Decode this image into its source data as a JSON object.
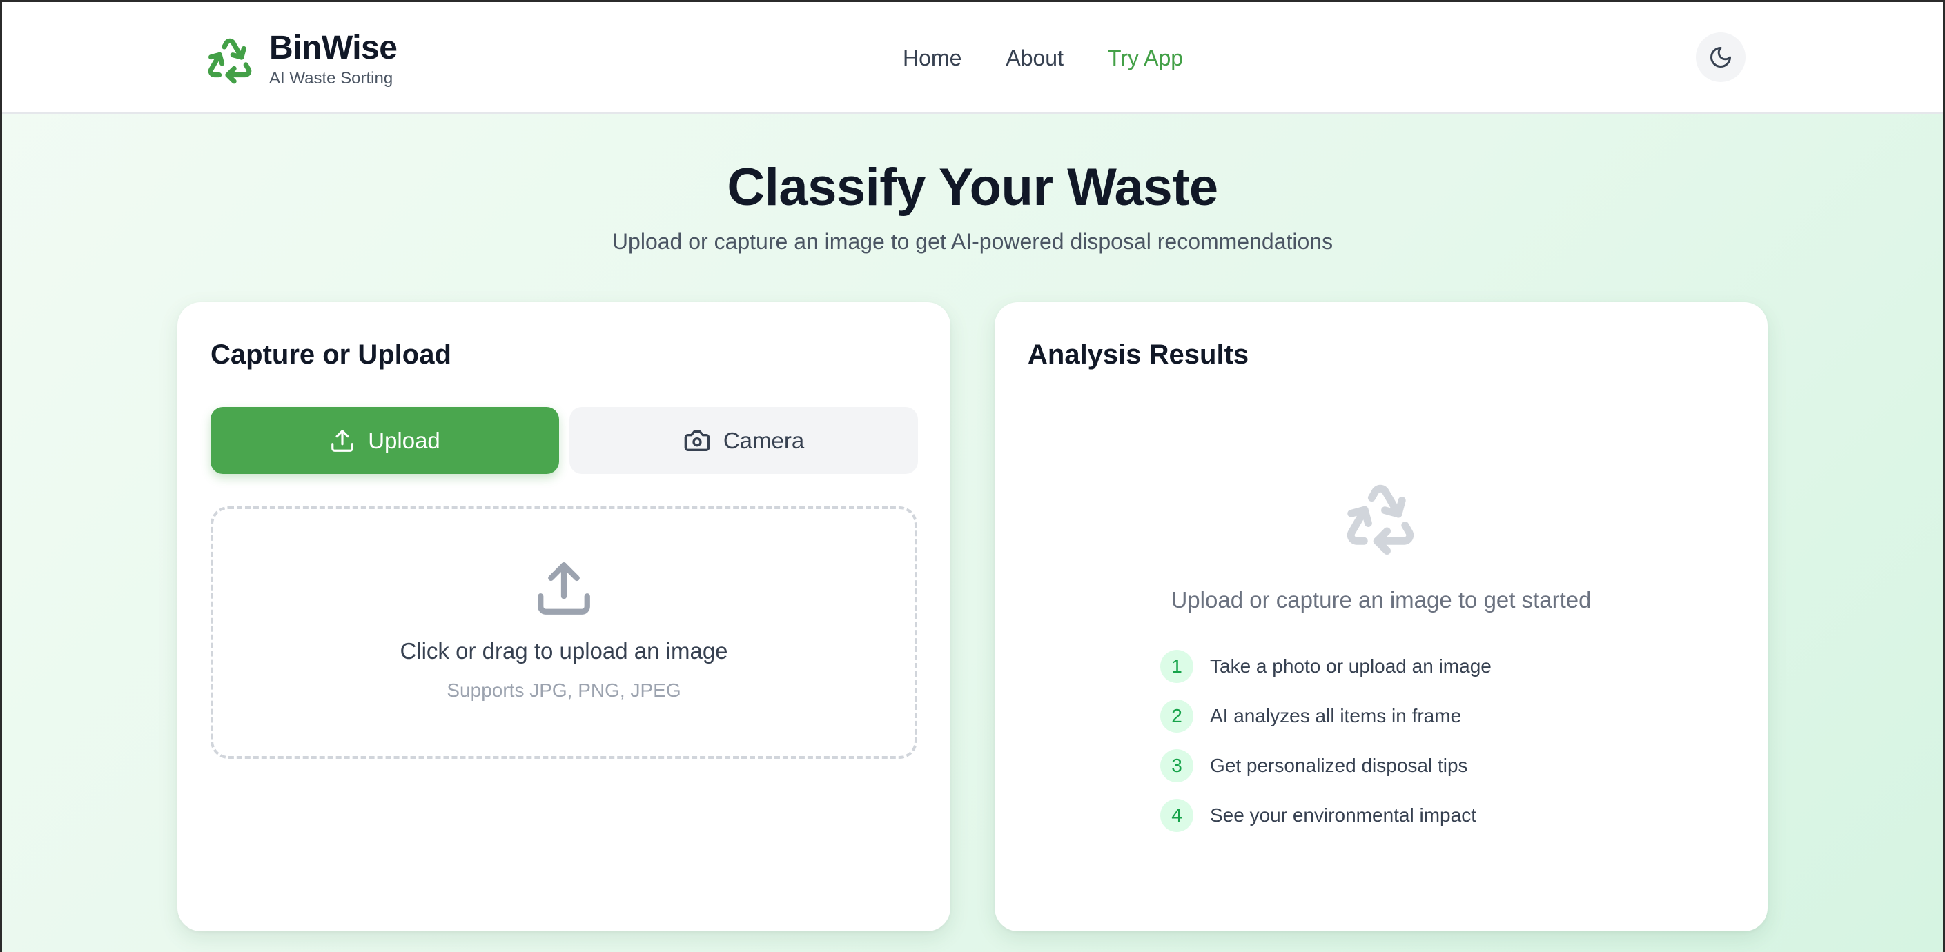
{
  "brand": {
    "name": "BinWise",
    "tagline": "AI Waste Sorting",
    "logo_icon": "recycle-icon",
    "accent_color": "#43a047"
  },
  "nav": {
    "links": [
      {
        "label": "Home",
        "active": false
      },
      {
        "label": "About",
        "active": false
      },
      {
        "label": "Try App",
        "active": true
      }
    ],
    "theme_toggle_icon": "moon-icon"
  },
  "hero": {
    "title": "Classify Your Waste",
    "subtitle": "Upload or capture an image to get AI-powered disposal recommendations"
  },
  "capture_card": {
    "title": "Capture or Upload",
    "tabs": [
      {
        "label": "Upload",
        "icon": "upload-icon",
        "selected": true
      },
      {
        "label": "Camera",
        "icon": "camera-icon",
        "selected": false
      }
    ],
    "dropzone": {
      "icon": "upload-icon",
      "title": "Click or drag to upload an image",
      "hint": "Supports JPG, PNG, JPEG"
    }
  },
  "results_card": {
    "title": "Analysis Results",
    "empty_icon": "recycle-icon",
    "empty_message": "Upload or capture an image to get started",
    "steps": [
      {
        "number": "1",
        "text": "Take a photo or upload an image"
      },
      {
        "number": "2",
        "text": "AI analyzes all items in frame"
      },
      {
        "number": "3",
        "text": "Get personalized disposal tips"
      },
      {
        "number": "4",
        "text": "See your environmental impact"
      }
    ]
  }
}
